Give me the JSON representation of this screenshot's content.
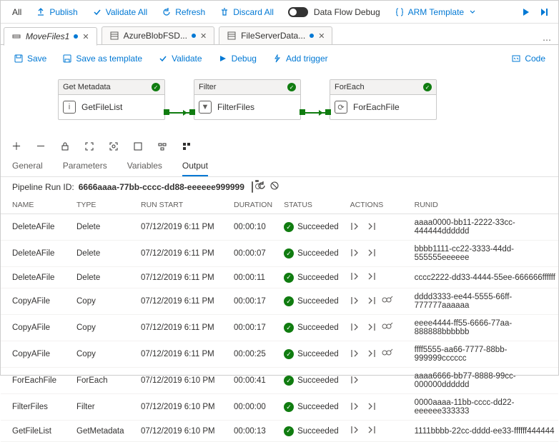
{
  "top_toolbar": {
    "all_label": "All",
    "publish": "Publish",
    "validate_all": "Validate All",
    "refresh": "Refresh",
    "discard_all": "Discard All",
    "debug_toggle_label": "Data Flow Debug",
    "arm_template": "ARM Template"
  },
  "tabs": [
    {
      "label": "MoveFiles1",
      "active": true,
      "dirty": true
    },
    {
      "label": "AzureBlobFSD...",
      "active": false,
      "dirty": true
    },
    {
      "label": "FileServerData...",
      "active": false,
      "dirty": true
    }
  ],
  "editor_toolbar": {
    "save": "Save",
    "save_as_template": "Save as template",
    "validate": "Validate",
    "debug": "Debug",
    "add_trigger": "Add trigger",
    "code": "Code"
  },
  "nodes": [
    {
      "head": "Get Metadata",
      "name": "GetFileList",
      "icon": "i"
    },
    {
      "head": "Filter",
      "name": "FilterFiles",
      "icon": "▼"
    },
    {
      "head": "ForEach",
      "name": "ForEachFile",
      "icon": "⟳"
    }
  ],
  "subtabs": [
    "General",
    "Parameters",
    "Variables",
    "Output"
  ],
  "subtab_active": "Output",
  "runid_label": "Pipeline Run ID:",
  "runid_value": "6666aaaa-77bb-cccc-dd88-eeeeee999999",
  "columns": [
    "NAME",
    "TYPE",
    "RUN START",
    "DURATION",
    "STATUS",
    "ACTIONS",
    "RUNID"
  ],
  "status_label": "Succeeded",
  "rows": [
    {
      "name": "DeleteAFile",
      "type": "Delete",
      "start": "07/12/2019 6:11 PM",
      "dur": "00:00:10",
      "actions": "io",
      "runid": "aaaa0000-bb11-2222-33cc-444444dddddd"
    },
    {
      "name": "DeleteAFile",
      "type": "Delete",
      "start": "07/12/2019 6:11 PM",
      "dur": "00:00:07",
      "actions": "io",
      "runid": "bbbb1111-cc22-3333-44dd-555555eeeeee"
    },
    {
      "name": "DeleteAFile",
      "type": "Delete",
      "start": "07/12/2019 6:11 PM",
      "dur": "00:00:11",
      "actions": "io",
      "runid": "cccc2222-dd33-4444-55ee-666666ffffff"
    },
    {
      "name": "CopyAFile",
      "type": "Copy",
      "start": "07/12/2019 6:11 PM",
      "dur": "00:00:17",
      "actions": "iog",
      "runid": "dddd3333-ee44-5555-66ff-777777aaaaaa"
    },
    {
      "name": "CopyAFile",
      "type": "Copy",
      "start": "07/12/2019 6:11 PM",
      "dur": "00:00:17",
      "actions": "iog",
      "runid": "eeee4444-ff55-6666-77aa-888888bbbbbb"
    },
    {
      "name": "CopyAFile",
      "type": "Copy",
      "start": "07/12/2019 6:11 PM",
      "dur": "00:00:25",
      "actions": "iog",
      "runid": "ffff5555-aa66-7777-88bb-999999cccccc"
    },
    {
      "name": "ForEachFile",
      "type": "ForEach",
      "start": "07/12/2019 6:10 PM",
      "dur": "00:00:41",
      "actions": "i",
      "runid": "aaaa6666-bb77-8888-99cc-000000dddddd"
    },
    {
      "name": "FilterFiles",
      "type": "Filter",
      "start": "07/12/2019 6:10 PM",
      "dur": "00:00:00",
      "actions": "io",
      "runid": "0000aaaa-11bb-cccc-dd22-eeeeee333333"
    },
    {
      "name": "GetFileList",
      "type": "GetMetadata",
      "start": "07/12/2019 6:10 PM",
      "dur": "00:00:13",
      "actions": "io",
      "runid": "1111bbbb-22cc-dddd-ee33-ffffff444444"
    }
  ]
}
